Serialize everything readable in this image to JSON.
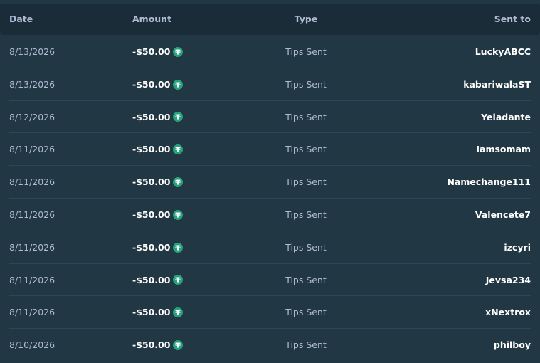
{
  "headers": {
    "date": "Date",
    "amount": "Amount",
    "type": "Type",
    "sent_to": "Sent to"
  },
  "currency_icon": "tether-usdt-icon",
  "colors": {
    "background": "#213743",
    "header_background": "#1a2c38",
    "coin": "#26a17b"
  },
  "rows": [
    {
      "date": "8/13/2026",
      "amount": "-$50.00",
      "type": "Tips Sent",
      "sent_to": "LuckyABCC"
    },
    {
      "date": "8/13/2026",
      "amount": "-$50.00",
      "type": "Tips Sent",
      "sent_to": "kabariwalaST"
    },
    {
      "date": "8/12/2026",
      "amount": "-$50.00",
      "type": "Tips Sent",
      "sent_to": "Yeladante"
    },
    {
      "date": "8/11/2026",
      "amount": "-$50.00",
      "type": "Tips Sent",
      "sent_to": "Iamsomam"
    },
    {
      "date": "8/11/2026",
      "amount": "-$50.00",
      "type": "Tips Sent",
      "sent_to": "Namechange111"
    },
    {
      "date": "8/11/2026",
      "amount": "-$50.00",
      "type": "Tips Sent",
      "sent_to": "Valencete7"
    },
    {
      "date": "8/11/2026",
      "amount": "-$50.00",
      "type": "Tips Sent",
      "sent_to": "izcyri"
    },
    {
      "date": "8/11/2026",
      "amount": "-$50.00",
      "type": "Tips Sent",
      "sent_to": "Jevsa234"
    },
    {
      "date": "8/11/2026",
      "amount": "-$50.00",
      "type": "Tips Sent",
      "sent_to": "xNextrox"
    },
    {
      "date": "8/10/2026",
      "amount": "-$50.00",
      "type": "Tips Sent",
      "sent_to": "philboy"
    }
  ]
}
